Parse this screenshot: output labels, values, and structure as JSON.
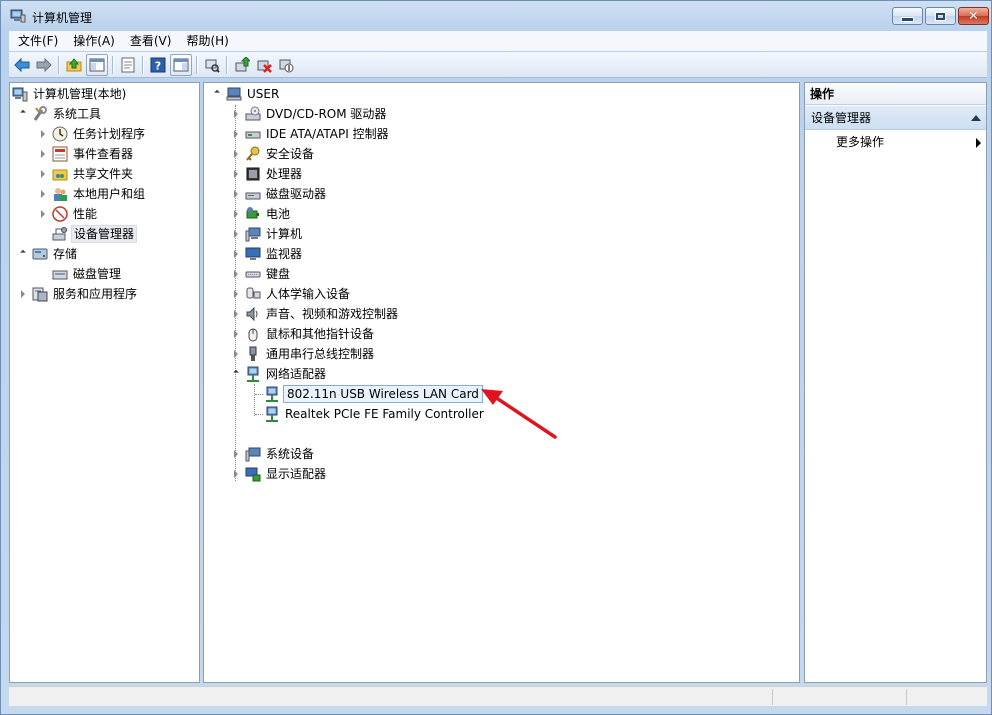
{
  "window": {
    "title": "计算机管理",
    "controls": [
      "minimize",
      "maximize",
      "close"
    ]
  },
  "menu": {
    "items": [
      "文件(F)",
      "操作(A)",
      "查看(V)",
      "帮助(H)"
    ]
  },
  "toolbar": {
    "icons": [
      "back-icon",
      "forward-icon",
      "up-folder-icon",
      "show-hide-tree-icon",
      "properties-icon",
      "help-icon",
      "show-hide-action-pane-icon",
      "scan-hardware-icon",
      "update-driver-icon",
      "uninstall-icon",
      "disable-device-icon"
    ]
  },
  "left_tree": {
    "root": "计算机管理(本地)",
    "system_tools": "系统工具",
    "task_scheduler": "任务计划程序",
    "event_viewer": "事件查看器",
    "shared_folders": "共享文件夹",
    "local_users": "本地用户和组",
    "performance": "性能",
    "device_manager": "设备管理器",
    "storage": "存储",
    "disk_management": "磁盘管理",
    "services_apps": "服务和应用程序"
  },
  "device_tree": {
    "root": "USER",
    "categories": [
      "DVD/CD-ROM 驱动器",
      "IDE ATA/ATAPI 控制器",
      "安全设备",
      "处理器",
      "磁盘驱动器",
      "电池",
      "计算机",
      "监视器",
      "键盘",
      "人体学输入设备",
      "声音、视频和游戏控制器",
      "鼠标和其他指针设备",
      "通用串行总线控制器",
      "网络适配器"
    ],
    "network_children": [
      "802.11n USB Wireless LAN Card",
      "Realtek PCIe FE Family Controller"
    ],
    "after_network": [
      "系统设备",
      "显示适配器"
    ]
  },
  "actions_pane": {
    "header": "操作",
    "section": "设备管理器",
    "more_actions": "更多操作"
  },
  "colors": {
    "accent_arrow": "#e0141e",
    "selection_blue": "#84acdd"
  }
}
